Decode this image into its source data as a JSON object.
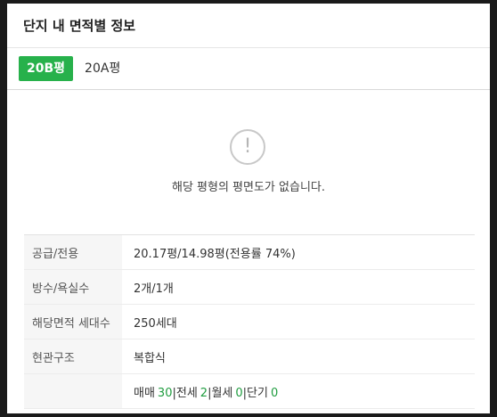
{
  "panel": {
    "title": "단지 내 면적별 정보"
  },
  "tabs": [
    {
      "label": "20B평",
      "active": true
    },
    {
      "label": "20A평",
      "active": false
    }
  ],
  "empty_state": {
    "icon": "exclamation-circle-icon",
    "icon_glyph": "!",
    "message": "해당 평형의 평면도가 없습니다."
  },
  "info": {
    "supply_area": {
      "label": "공급/전용",
      "value": "20.17평/14.98평(전용률 74%)"
    },
    "rooms": {
      "label": "방수/욕실수",
      "value": "2개/1개"
    },
    "households": {
      "label": "해당면적 세대수",
      "value": "250세대"
    },
    "entrance": {
      "label": "현관구조",
      "value": "복합식"
    },
    "listings": {
      "label": "",
      "sale": {
        "label": "매매",
        "count": "30"
      },
      "jeonse": {
        "label": "전세",
        "count": "2"
      },
      "monthly": {
        "label": "월세",
        "count": "0"
      },
      "short": {
        "label": "단기",
        "count": "0"
      }
    }
  },
  "colors": {
    "accent": "#27b14b",
    "count": "#1f9c3f"
  }
}
